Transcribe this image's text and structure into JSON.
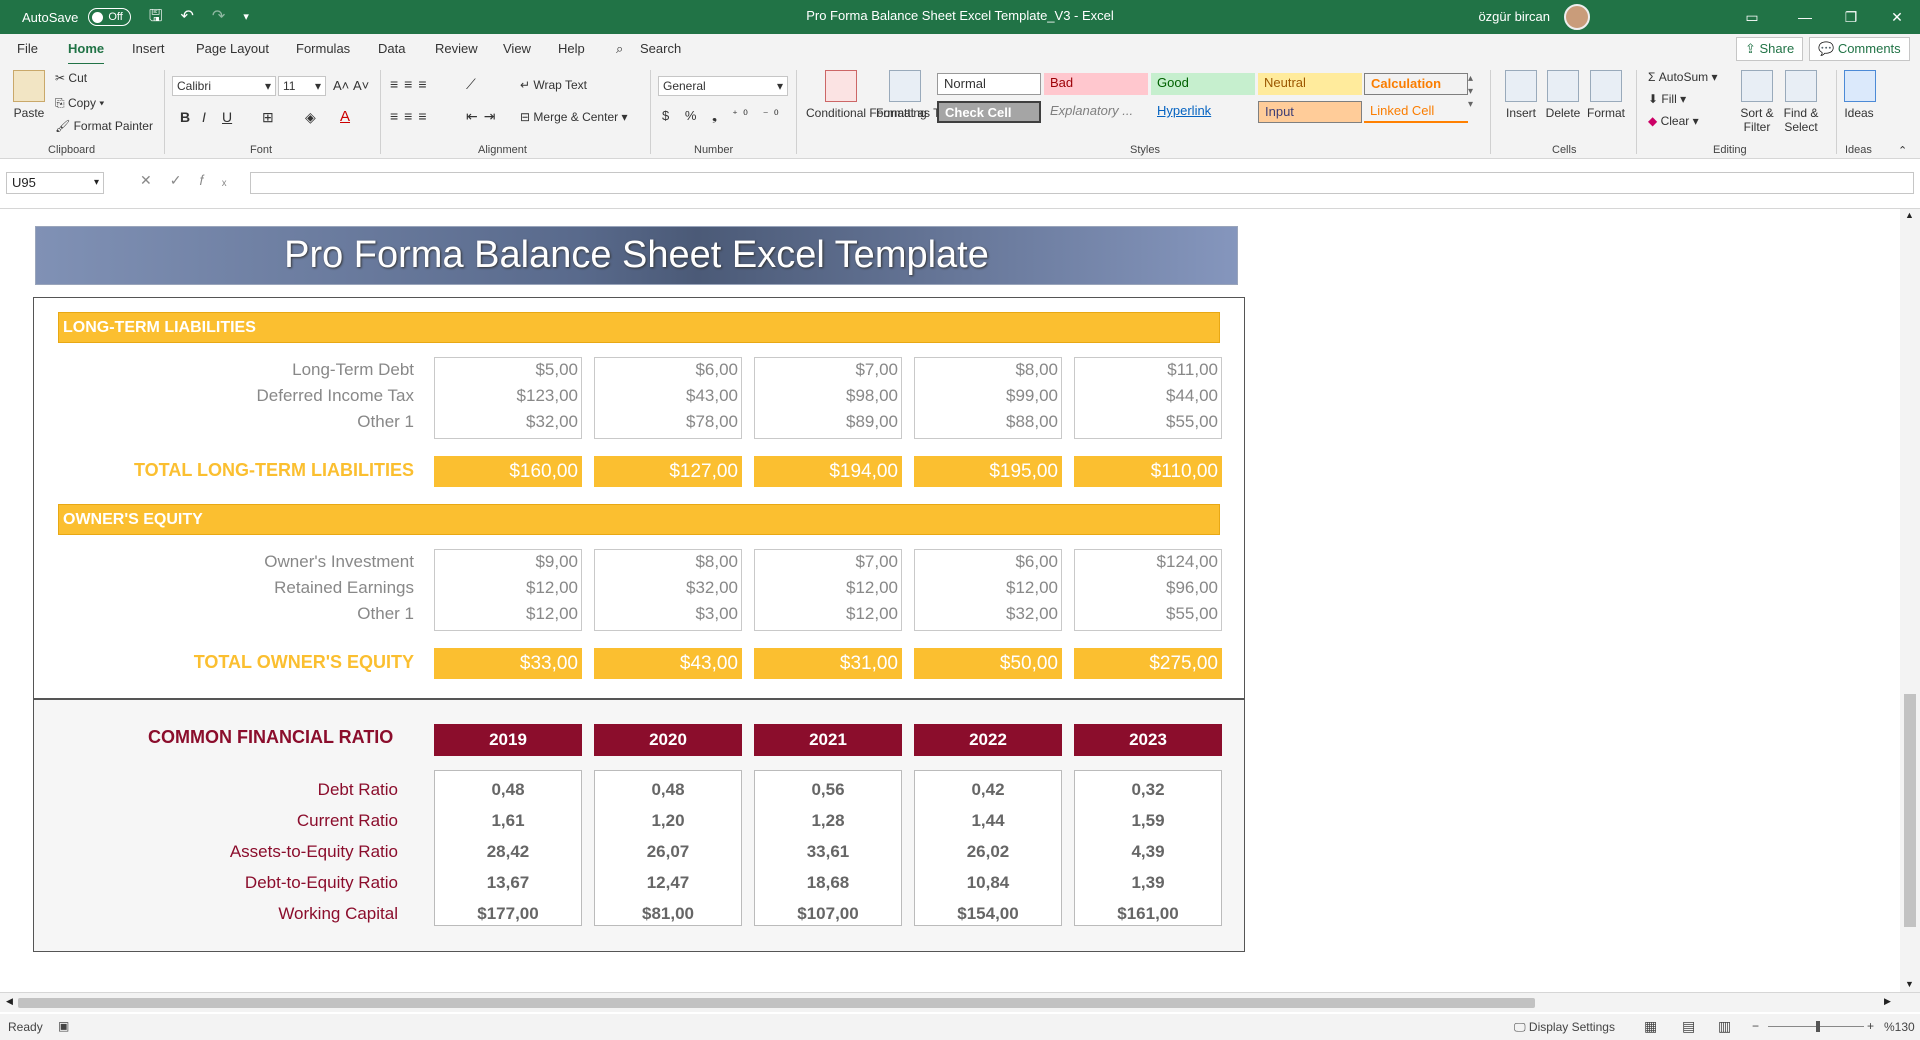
{
  "titlebar": {
    "autosave_label": "AutoSave",
    "autosave_state": "Off",
    "title": "Pro Forma Balance Sheet Excel Template_V3  -  Excel",
    "user": "özgür bircan"
  },
  "tabs": [
    "File",
    "Home",
    "Insert",
    "Page Layout",
    "Formulas",
    "Data",
    "Review",
    "View",
    "Help"
  ],
  "search_label": "Search",
  "share_label": "Share",
  "comments_label": "Comments",
  "ribbon": {
    "clipboard": {
      "paste": "Paste",
      "cut": "Cut",
      "copy": "Copy",
      "format_painter": "Format Painter",
      "label": "Clipboard"
    },
    "font": {
      "name": "Calibri",
      "size": "11",
      "label": "Font"
    },
    "alignment": {
      "wrap": "Wrap Text",
      "merge": "Merge & Center",
      "label": "Alignment"
    },
    "number": {
      "format": "General",
      "label": "Number"
    },
    "styles": {
      "conditional": "Conditional Formatting",
      "format_table": "Format as Table",
      "normal": "Normal",
      "bad": "Bad",
      "good": "Good",
      "neutral": "Neutral",
      "calculation": "Calculation",
      "check_cell": "Check Cell",
      "explanatory": "Explanatory ...",
      "hyperlink": "Hyperlink",
      "input": "Input",
      "linked_cell": "Linked Cell",
      "label": "Styles"
    },
    "cells": {
      "insert": "Insert",
      "delete": "Delete",
      "format": "Format",
      "label": "Cells"
    },
    "editing": {
      "autosum": "AutoSum",
      "fill": "Fill",
      "clear": "Clear",
      "sort": "Sort & Filter",
      "find": "Find & Select",
      "label": "Editing"
    },
    "ideas": {
      "ideas": "Ideas",
      "label": "Ideas"
    }
  },
  "namebox": "U95",
  "sheet": {
    "banner": "Pro Forma Balance Sheet Excel Template",
    "ltl": {
      "header": "LONG-TERM LIABILITIES",
      "rows": [
        {
          "label": "Long-Term Debt",
          "values": [
            "$5,00",
            "$6,00",
            "$7,00",
            "$8,00",
            "$11,00"
          ]
        },
        {
          "label": "Deferred Income Tax",
          "values": [
            "$123,00",
            "$43,00",
            "$98,00",
            "$99,00",
            "$44,00"
          ]
        },
        {
          "label": "Other 1",
          "values": [
            "$32,00",
            "$78,00",
            "$89,00",
            "$88,00",
            "$55,00"
          ]
        }
      ],
      "total_label": "TOTAL LONG-TERM LIABILITIES",
      "totals": [
        "$160,00",
        "$127,00",
        "$194,00",
        "$195,00",
        "$110,00"
      ]
    },
    "equity": {
      "header": "OWNER'S EQUITY",
      "rows": [
        {
          "label": "Owner's Investment",
          "values": [
            "$9,00",
            "$8,00",
            "$7,00",
            "$6,00",
            "$124,00"
          ]
        },
        {
          "label": "Retained Earnings",
          "values": [
            "$12,00",
            "$32,00",
            "$12,00",
            "$12,00",
            "$96,00"
          ]
        },
        {
          "label": "Other 1",
          "values": [
            "$12,00",
            "$3,00",
            "$12,00",
            "$32,00",
            "$55,00"
          ]
        }
      ],
      "total_label": "TOTAL OWNER'S EQUITY",
      "totals": [
        "$33,00",
        "$43,00",
        "$31,00",
        "$50,00",
        "$275,00"
      ]
    },
    "ratios": {
      "header": "COMMON FINANCIAL RATIO",
      "years": [
        "2019",
        "2020",
        "2021",
        "2022",
        "2023"
      ],
      "rows": [
        {
          "label": "Debt Ratio",
          "values": [
            "0,48",
            "0,48",
            "0,56",
            "0,42",
            "0,32"
          ]
        },
        {
          "label": "Current Ratio",
          "values": [
            "1,61",
            "1,20",
            "1,28",
            "1,44",
            "1,59"
          ]
        },
        {
          "label": "Assets-to-Equity Ratio",
          "values": [
            "28,42",
            "26,07",
            "33,61",
            "26,02",
            "4,39"
          ]
        },
        {
          "label": "Debt-to-Equity Ratio",
          "values": [
            "13,67",
            "12,47",
            "18,68",
            "10,84",
            "1,39"
          ]
        },
        {
          "label": "Working Capital",
          "values": [
            "$177,00",
            "$81,00",
            "$107,00",
            "$154,00",
            "$161,00"
          ]
        }
      ]
    }
  },
  "status": {
    "ready": "Ready",
    "display_settings": "Display Settings",
    "zoom": "%130"
  },
  "colors": {
    "excel_green": "#217346",
    "accent_yellow": "#fbbf30",
    "ratio_red": "#8b0d2c"
  }
}
